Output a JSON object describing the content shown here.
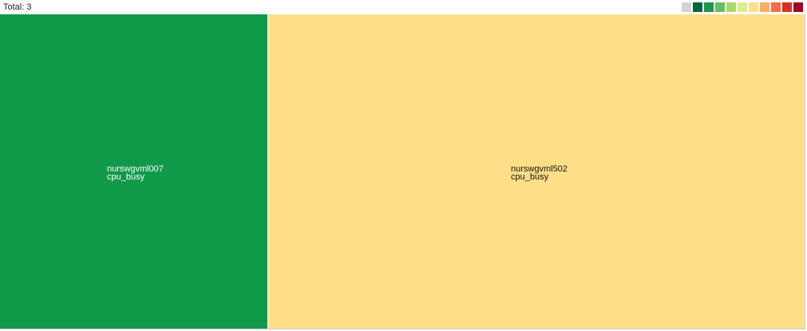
{
  "header": {
    "total_label": "Total: 3"
  },
  "legend": {
    "swatches": [
      "#d3d3d3",
      "#006837",
      "#1a9850",
      "#66bd63",
      "#a6d96a",
      "#d9ef8b",
      "#fee08b",
      "#fdae61",
      "#f46d43",
      "#d73027",
      "#a50026"
    ]
  },
  "treemap": {
    "cells": [
      {
        "host": "nurswgvml007",
        "metric": "cpu_busy",
        "color": "#11994a",
        "text_color": "#ffffff"
      },
      {
        "host": "nurswgvml502",
        "metric": "cpu_busy",
        "color": "#fedf88",
        "text_color": "#111111"
      }
    ]
  }
}
